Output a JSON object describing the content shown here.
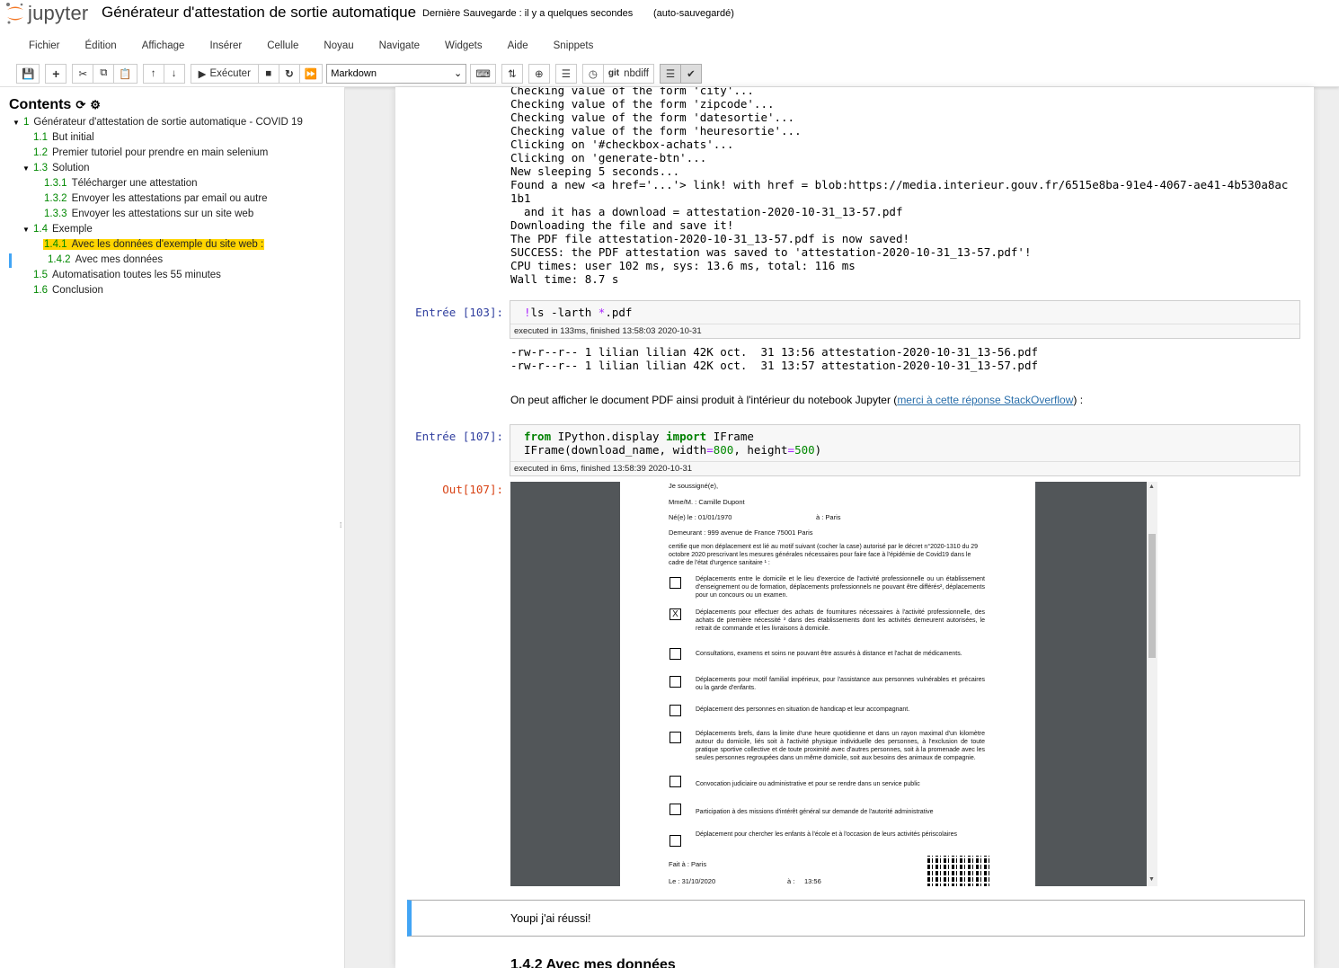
{
  "header": {
    "logo_text": "jupyter",
    "title": "Générateur d'attestation de sortie automatique",
    "save_status": "Dernière Sauvegarde : il y a quelques secondes",
    "autosave": "(auto-sauvegardé)"
  },
  "menu": [
    "Fichier",
    "Édition",
    "Affichage",
    "Insérer",
    "Cellule",
    "Noyau",
    "Navigate",
    "Widgets",
    "Aide",
    "Snippets"
  ],
  "toolbar": {
    "run_label": "Exécuter",
    "cell_type": "Markdown",
    "nbdiff_label": "nbdiff",
    "git_label": "git"
  },
  "toc": {
    "title": "Contents",
    "items": [
      {
        "num": "1",
        "label": "Générateur d'attestation de sortie automatique - COVID 19"
      },
      {
        "num": "1.1",
        "label": "But initial"
      },
      {
        "num": "1.2",
        "label": "Premier tutoriel pour prendre en main selenium"
      },
      {
        "num": "1.3",
        "label": "Solution"
      },
      {
        "num": "1.3.1",
        "label": "Télécharger une attestation"
      },
      {
        "num": "1.3.2",
        "label": "Envoyer les attestations par email ou autre"
      },
      {
        "num": "1.3.3",
        "label": "Envoyer les attestations sur un site web"
      },
      {
        "num": "1.4",
        "label": "Exemple"
      },
      {
        "num": "1.4.1",
        "label": "Avec les données d'exemple du site web :"
      },
      {
        "num": "1.4.2",
        "label": "Avec mes données"
      },
      {
        "num": "1.5",
        "label": "Automatisation toutes les 55 minutes"
      },
      {
        "num": "1.6",
        "label": "Conclusion"
      }
    ]
  },
  "cells": {
    "stdout_lines": [
      "Checking value of the form 'city'...",
      "Checking value of the form 'zipcode'...",
      "Checking value of the form 'datesortie'...",
      "Checking value of the form 'heuresortie'...",
      "Clicking on '#checkbox-achats'...",
      "Clicking on 'generate-btn'...",
      "New sleeping 5 seconds...",
      "Found a new <a href='...'> link! with href = blob:https://media.interieur.gouv.fr/6515e8ba-91e4-4067-ae41-4b530a8ac",
      "1b1",
      "  and it has a download = attestation-2020-10-31_13-57.pdf",
      "Downloading the file and save it!",
      "The PDF file attestation-2020-10-31_13-57.pdf is now saved!",
      "SUCCESS: the PDF attestation was saved to 'attestation-2020-10-31_13-57.pdf'!",
      "CPU times: user 102 ms, sys: 13.6 ms, total: 116 ms",
      "Wall time: 8.7 s"
    ],
    "cell103": {
      "prompt": "Entrée [103]:",
      "code_bang": "!",
      "code_rest": "ls -larth ",
      "code_star": "*",
      "code_end": ".pdf",
      "exec": "executed in 133ms, finished 13:58:03 2020-10-31",
      "output": "-rw-r--r-- 1 lilian lilian 42K oct.  31 13:56 attestation-2020-10-31_13-56.pdf\n-rw-r--r-- 1 lilian lilian 42K oct.  31 13:57 attestation-2020-10-31_13-57.pdf"
    },
    "markdown1": {
      "before": "On peut afficher le document PDF ainsi produit à l'intérieur du notebook Jupyter (",
      "link": "merci à cette réponse StackOverflow",
      "after": ") :"
    },
    "cell107": {
      "prompt": "Entrée [107]:",
      "out_prompt": "Out[107]:",
      "line1_kw1": "from",
      "line1_mod": " IPython.display ",
      "line1_kw2": "import",
      "line1_name": " IFrame",
      "line2_a": "IFrame(download_name, width",
      "line2_eq": "=",
      "line2_w": "800",
      "line2_b": ", height",
      "line2_h": "500",
      "line2_c": ")",
      "exec": "executed in 6ms, finished 13:58:39 2020-10-31"
    },
    "pdf": {
      "l1": "Je soussigné(e),",
      "l2": "Mme/M. :   Camille Dupont",
      "l3a": "Né(e) le :   01/01/1970",
      "l3b": "à : Paris",
      "l4": "Demeurant :  999 avenue de France 75001 Paris",
      "certify": "certifie que mon déplacement est lié au motif suivant (cocher la case) autorisé par le décret n°2020-1310 du 29 octobre 2020 prescrivant les mesures générales nécessaires pour faire face à l'épidémie de Covid19 dans le cadre de l'état d'urgence sanitaire ¹ :",
      "options": [
        "Déplacements entre le domicile et le lieu d'exercice de l'activité professionnelle ou un établissement d'enseignement ou de formation, déplacements professionnels ne pouvant être différés², déplacements pour un concours ou un examen.",
        "Déplacements pour effectuer des achats de fournitures nécessaires à l'activité professionnelle, des achats de première nécessité ³ dans des établissements dont les activités demeurent autorisées, le retrait de commande et les livraisons à domicile.",
        "Consultations, examens et soins ne pouvant être assurés à distance et l'achat de médicaments.",
        "Déplacements pour motif familial impérieux, pour l'assistance aux personnes vulnérables et précaires ou la garde d'enfants.",
        "Déplacement des personnes en situation de handicap et leur accompagnant.",
        "Déplacements brefs, dans la limite d'une heure quotidienne et dans un rayon maximal d'un kilomètre autour du domicile, liés soit à l'activité physique individuelle des personnes, à l'exclusion de toute pratique sportive collective et de toute proximité avec d'autres personnes, soit à la promenade avec les seules personnes regroupées dans un même domicile, soit aux besoins des animaux de compagnie.",
        "Convocation judiciaire ou administrative et pour se rendre dans un service public",
        "Participation à des missions d'intérêt général sur demande de l'autorité administrative",
        "Déplacement pour chercher les enfants à l'école et à l'occasion de leurs activités périscolaires"
      ],
      "checked_mark": "X",
      "fait_a": "Fait à : Paris",
      "le": "Le : 31/10/2020",
      "a": "à :",
      "time": "13:56"
    },
    "markdown2": "Youpi j'ai réussi!",
    "heading": "1.4.2  Avec mes données"
  }
}
